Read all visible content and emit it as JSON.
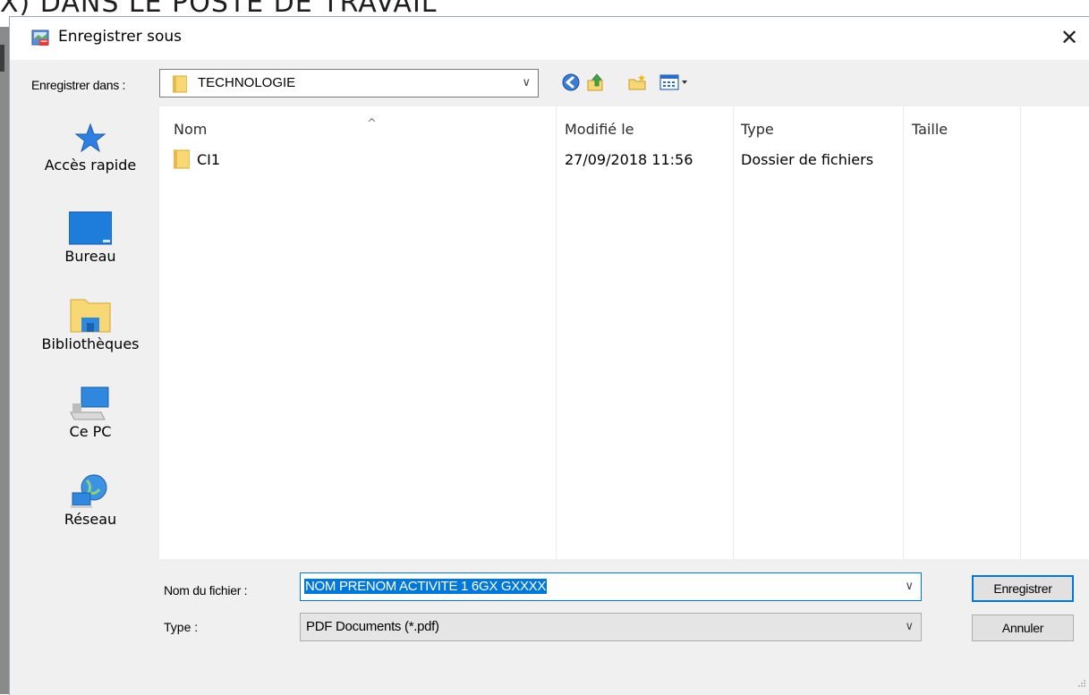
{
  "background": {
    "heading": "X) DANS LE POSTE DE TRAVAIL"
  },
  "dialog": {
    "title": "Enregistrer sous",
    "close_glyph": "✕"
  },
  "location": {
    "label": "Enregistrer dans :",
    "value": "TECHNOLOGIE",
    "chevron": "∨"
  },
  "toolbar": [
    {
      "name": "back-icon"
    },
    {
      "name": "up-folder-icon"
    },
    {
      "name": "new-folder-icon"
    },
    {
      "name": "view-menu-icon"
    }
  ],
  "places": [
    {
      "label": "Accès rapide",
      "icon": "star-icon"
    },
    {
      "label": "Bureau",
      "icon": "desktop-icon"
    },
    {
      "label": "Bibliothèques",
      "icon": "libraries-icon"
    },
    {
      "label": "Ce PC",
      "icon": "computer-icon"
    },
    {
      "label": "Réseau",
      "icon": "network-icon"
    }
  ],
  "list": {
    "columns": [
      "Nom",
      "Modifié le",
      "Type",
      "Taille"
    ],
    "sort_glyph": "^",
    "rows": [
      {
        "name": "CI1",
        "modified": "27/09/2018 11:56",
        "type": "Dossier de fichiers",
        "size": ""
      }
    ]
  },
  "filename": {
    "label": "Nom du fichier :",
    "value": "NOM PRENOM ACTIVITE 1 6GX GXXXX",
    "chevron": "∨"
  },
  "filetype": {
    "label": "Type :",
    "value": "PDF Documents (*.pdf)",
    "chevron": "∨"
  },
  "buttons": {
    "save": "Enregistrer",
    "cancel": "Annuler"
  },
  "colors": {
    "accent": "#0078d7",
    "folder": "#f8d775",
    "dialog_bg": "#f0f0f0"
  }
}
